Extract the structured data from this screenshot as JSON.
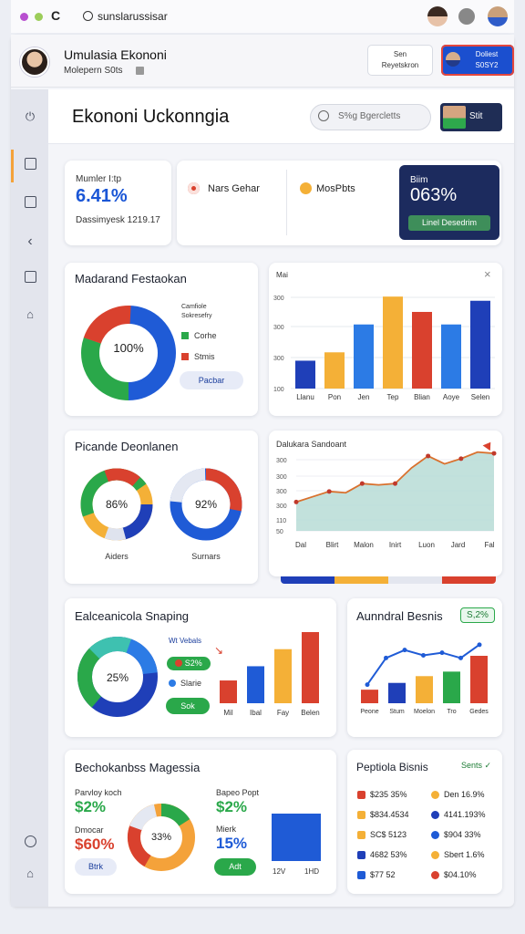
{
  "browser": {
    "url": "sunslarussisar"
  },
  "header": {
    "app_name": "Umulasia Ekononi",
    "subtitle": "Molepern S0ts",
    "btn1_line1": "Sen",
    "btn1_line2": "Reyetskron",
    "btn2_line1": "Doliest",
    "btn2_line2": "S0SY2"
  },
  "page": {
    "title": "Ekononi Uckonngia",
    "search_placeholder": "S%g  Bgercletts",
    "user_button": "Stit"
  },
  "kpis": {
    "card1_label": "Mumler I:tp",
    "card1_value": "6.41%",
    "card1_sub": "Dassimyesk 1219.17",
    "card2_a": "Nars Gehar",
    "card2_b": "MosPbts",
    "card3_label": "Biim",
    "card3_value": "063%",
    "card3_button": "Linel Desedrim"
  },
  "panel_donut": {
    "title": "Madarand Festaokan",
    "center": "100%",
    "legend_title_1": "Camfiole",
    "legend_title_2": "Sokresefry",
    "legend": [
      "Corhe",
      "Stmis"
    ],
    "button": "Pacbar"
  },
  "panel_bar1": {
    "title": "Mai",
    "close": "×",
    "chart_data": {
      "type": "bar",
      "categories": [
        "Llanu",
        "Pon",
        "Jen",
        "Tep",
        "Blian",
        "Aoye",
        "Selen"
      ],
      "values": [
        100,
        130,
        230,
        330,
        275,
        230,
        315
      ],
      "colors": [
        "#1f3fb8",
        "#f4b037",
        "#2c7be5",
        "#f4b037",
        "#d9412e",
        "#2c7be5",
        "#1f3fb8"
      ],
      "yticks": [
        "300",
        "300",
        "300",
        "100"
      ],
      "ylim": [
        0,
        360
      ]
    }
  },
  "panel_rings": {
    "title": "Picande Deonlanen",
    "ring1_value": "86%",
    "ring1_label": "Aiders",
    "ring2_value": "92%",
    "ring2_label": "Surnars"
  },
  "panel_area": {
    "title": "Dalukara Sandoant",
    "chart_data": {
      "type": "area",
      "categories": [
        "Dal",
        "Blirt",
        "Malon",
        "Inirt",
        "Luon",
        "Jard",
        "Fal"
      ],
      "x": [
        0,
        1,
        2,
        3,
        4,
        5,
        6,
        7,
        8,
        9,
        10,
        11,
        12
      ],
      "values": [
        110,
        130,
        150,
        145,
        180,
        175,
        180,
        240,
        285,
        255,
        275,
        300,
        295
      ],
      "yticks": [
        "300",
        "300",
        "300",
        "300",
        "110",
        "50"
      ],
      "ylim": [
        0,
        330
      ]
    }
  },
  "panel_snap": {
    "title": "Ealceanicola Snaping",
    "center": "25%",
    "legend_title": "Wt Vebals",
    "pill_pct": "S2%",
    "legend_item": "Slarie",
    "button": "Sok",
    "chart_data": {
      "type": "bar",
      "categories": [
        "Mil",
        "Ibal",
        "Fay",
        "Belen"
      ],
      "values": [
        40,
        65,
        95,
        125
      ],
      "colors": [
        "#d9412e",
        "#1f5bd6",
        "#f4b037",
        "#d9412e"
      ]
    }
  },
  "panel_annual": {
    "title": "Aunndral Besnis",
    "badge": "S,2%",
    "chart_data": {
      "type": "bar",
      "categories": [
        "Peone",
        "Stum",
        "Moelon",
        "Tro",
        "Gedes"
      ],
      "values": [
        30,
        45,
        60,
        70,
        105
      ],
      "line_values": [
        35,
        85,
        100,
        90,
        95,
        85,
        110
      ],
      "colors": [
        "#d9412e",
        "#1f3fb8",
        "#f4b037",
        "#2aa84a",
        "#d9412e"
      ]
    }
  },
  "panel_market": {
    "title": "Bechokanbss Magessia",
    "stat1_label": "Parvloy koch",
    "stat1_value": "$2%",
    "stat2_label": "Dmocar",
    "stat2_value": "$60%",
    "button_left": "Btrk",
    "donut_center": "33%",
    "stat3_label": "Bapeo Popt",
    "stat3_value": "$2%",
    "stat4_label": "Mierk",
    "stat4_value": "15%",
    "button_right": "Adt",
    "bar_labels": [
      "12V",
      "1HD"
    ]
  },
  "panel_list": {
    "title": "Peptiola Bisnis",
    "action": "Sents",
    "left": [
      "$235 35%",
      "$834.4534",
      "SC$ 5123",
      "4682 53%",
      "$77 52"
    ],
    "right": [
      "Den 16.9%",
      "4141.193%",
      "$904 33%",
      "Sbert 1.6%",
      "$04.10%"
    ],
    "left_colors": [
      "#d9412e",
      "#f4b037",
      "#f4b037",
      "#1f3fb8",
      "#1f5bd6"
    ],
    "right_colors": [
      "#f4b037",
      "#1f3fb8",
      "#1f5bd6",
      "#f4b037",
      "#d9412e"
    ]
  }
}
